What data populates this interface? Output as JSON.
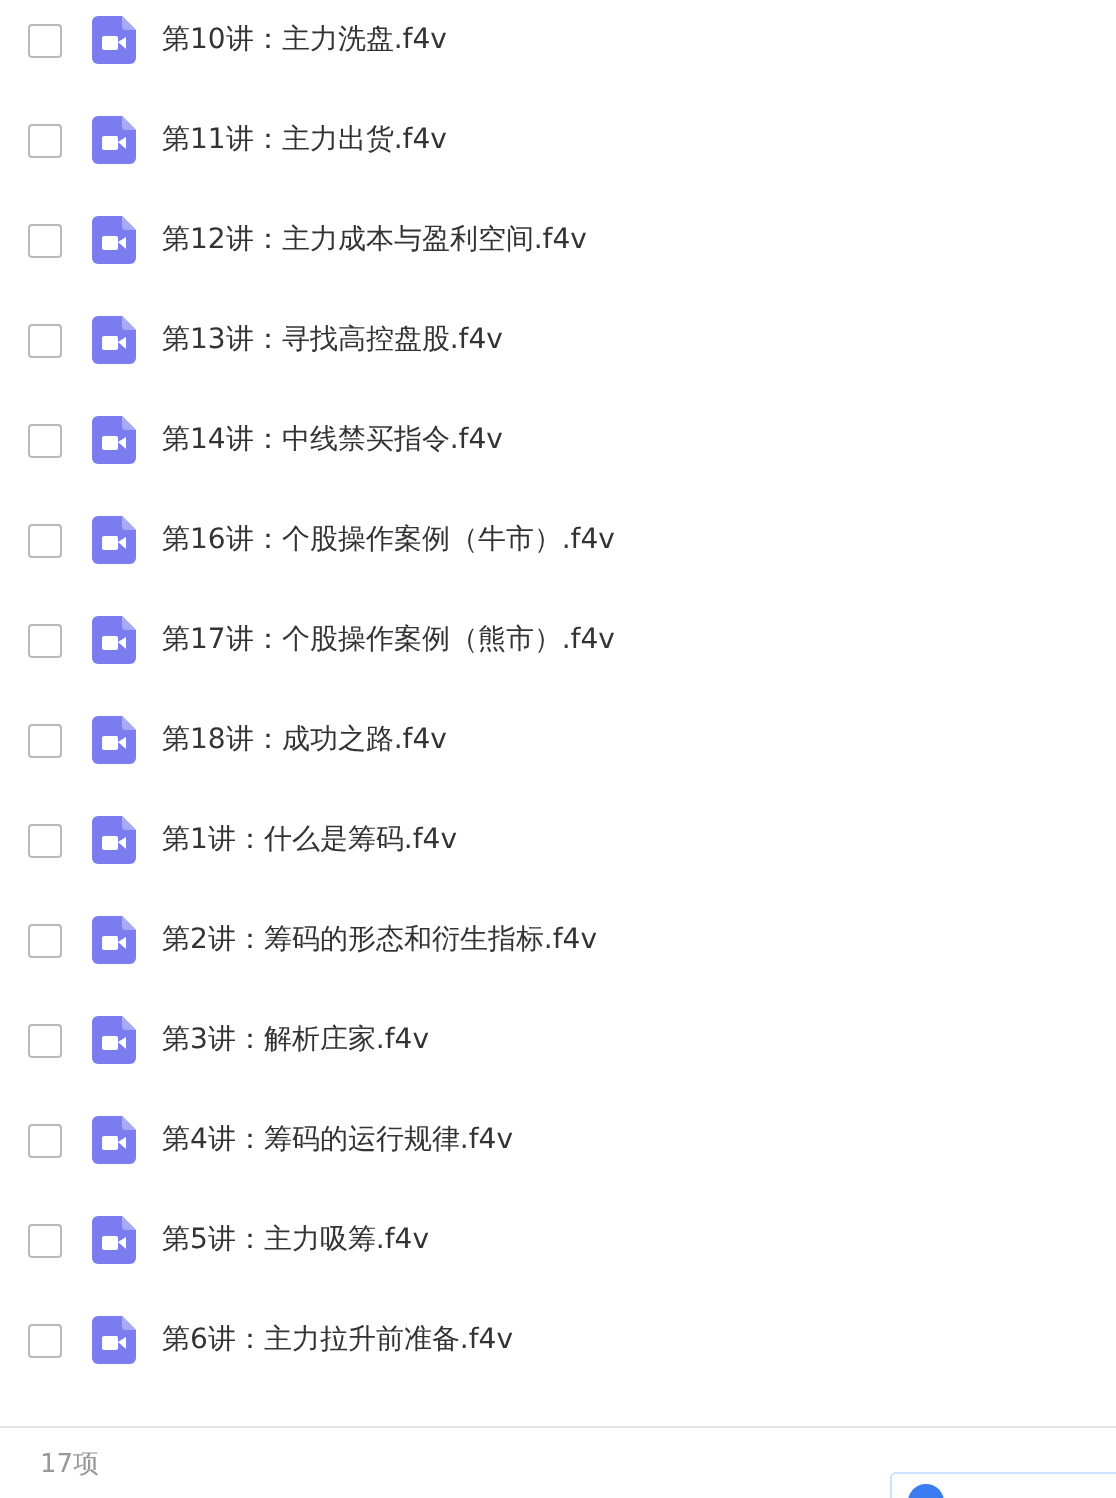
{
  "files": [
    {
      "name": "第10讲：主力洗盘.f4v",
      "checked": false
    },
    {
      "name": "第11讲：主力出货.f4v",
      "checked": false
    },
    {
      "name": "第12讲：主力成本与盈利空间.f4v",
      "checked": false
    },
    {
      "name": "第13讲：寻找高控盘股.f4v",
      "checked": false
    },
    {
      "name": "第14讲：中线禁买指令.f4v",
      "checked": false
    },
    {
      "name": "第16讲：个股操作案例（牛市）.f4v",
      "checked": false
    },
    {
      "name": "第17讲：个股操作案例（熊市）.f4v",
      "checked": false
    },
    {
      "name": "第18讲：成功之路.f4v",
      "checked": false
    },
    {
      "name": "第1讲：什么是筹码.f4v",
      "checked": false
    },
    {
      "name": "第2讲：筹码的形态和衍生指标.f4v",
      "checked": false
    },
    {
      "name": "第3讲：解析庄家.f4v",
      "checked": false
    },
    {
      "name": "第4讲：筹码的运行规律.f4v",
      "checked": false
    },
    {
      "name": "第5讲：主力吸筹.f4v",
      "checked": false
    },
    {
      "name": "第6讲：主力拉升前准备.f4v",
      "checked": false
    }
  ],
  "footer": {
    "count": "17项"
  }
}
